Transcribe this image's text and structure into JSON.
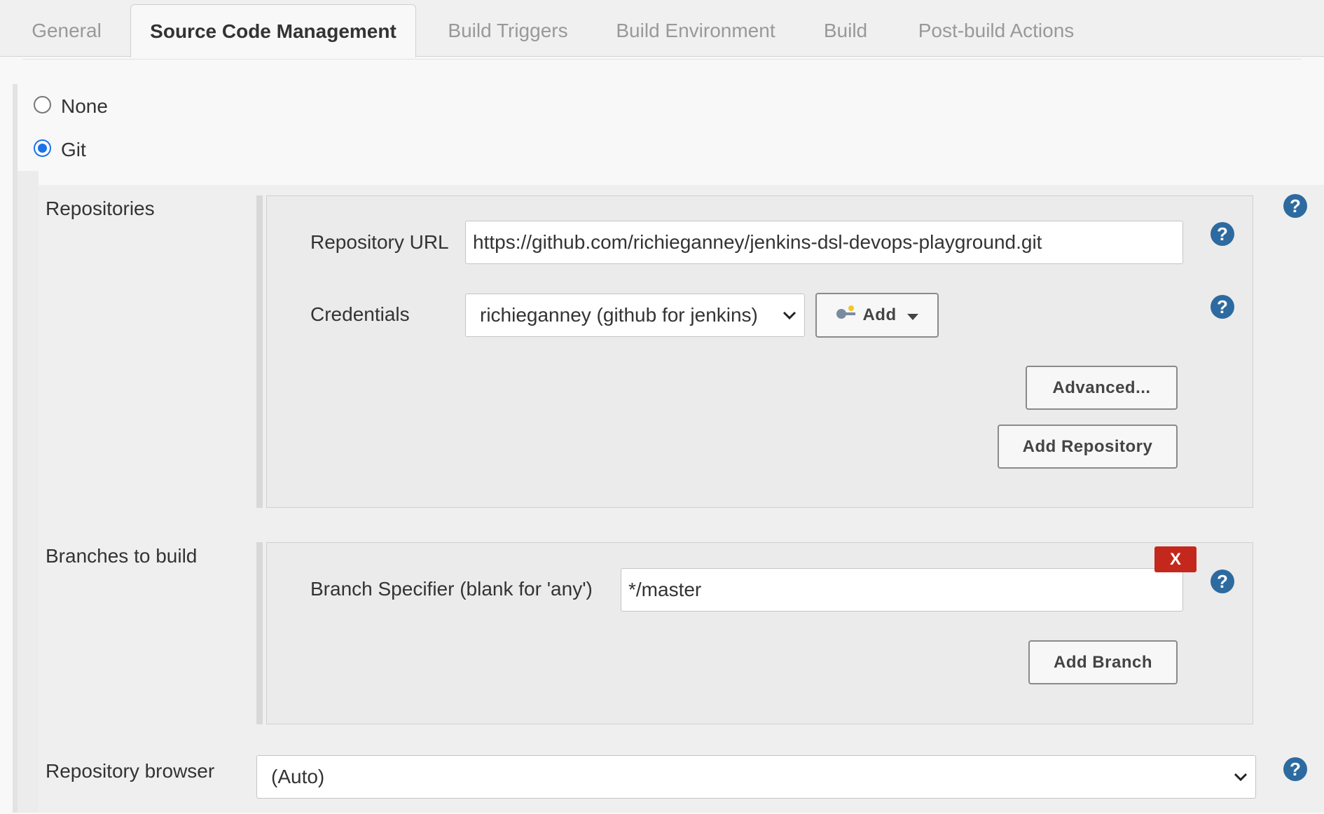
{
  "tabs": [
    {
      "label": "General",
      "active": false
    },
    {
      "label": "Source Code Management",
      "active": true
    },
    {
      "label": "Build Triggers",
      "active": false
    },
    {
      "label": "Build Environment",
      "active": false
    },
    {
      "label": "Build",
      "active": false
    },
    {
      "label": "Post-build Actions",
      "active": false
    }
  ],
  "scm": {
    "options": [
      {
        "label": "None",
        "checked": false
      },
      {
        "label": "Git",
        "checked": true
      }
    ]
  },
  "repositories": {
    "label": "Repositories",
    "url_label": "Repository URL",
    "url_value": "https://github.com/richieganney/jenkins-dsl-devops-playground.git",
    "credentials_label": "Credentials",
    "credentials_value": "richieganney (github for jenkins)",
    "add_label": "Add",
    "advanced_label": "Advanced...",
    "add_repository_label": "Add Repository"
  },
  "branches": {
    "label": "Branches to build",
    "specifier_label": "Branch Specifier (blank for 'any')",
    "specifier_value": "*/master",
    "delete_label": "X",
    "add_branch_label": "Add Branch"
  },
  "browser": {
    "label": "Repository browser",
    "value": "(Auto)"
  },
  "help_glyph": "?",
  "icons": {
    "help": "help-icon",
    "credentials_key": "key-icon",
    "dropdown": "chevron-down-icon"
  },
  "colors": {
    "help": "#2d6aa0",
    "delete": "#c4281c",
    "radio_checked": "#1a73e8"
  }
}
